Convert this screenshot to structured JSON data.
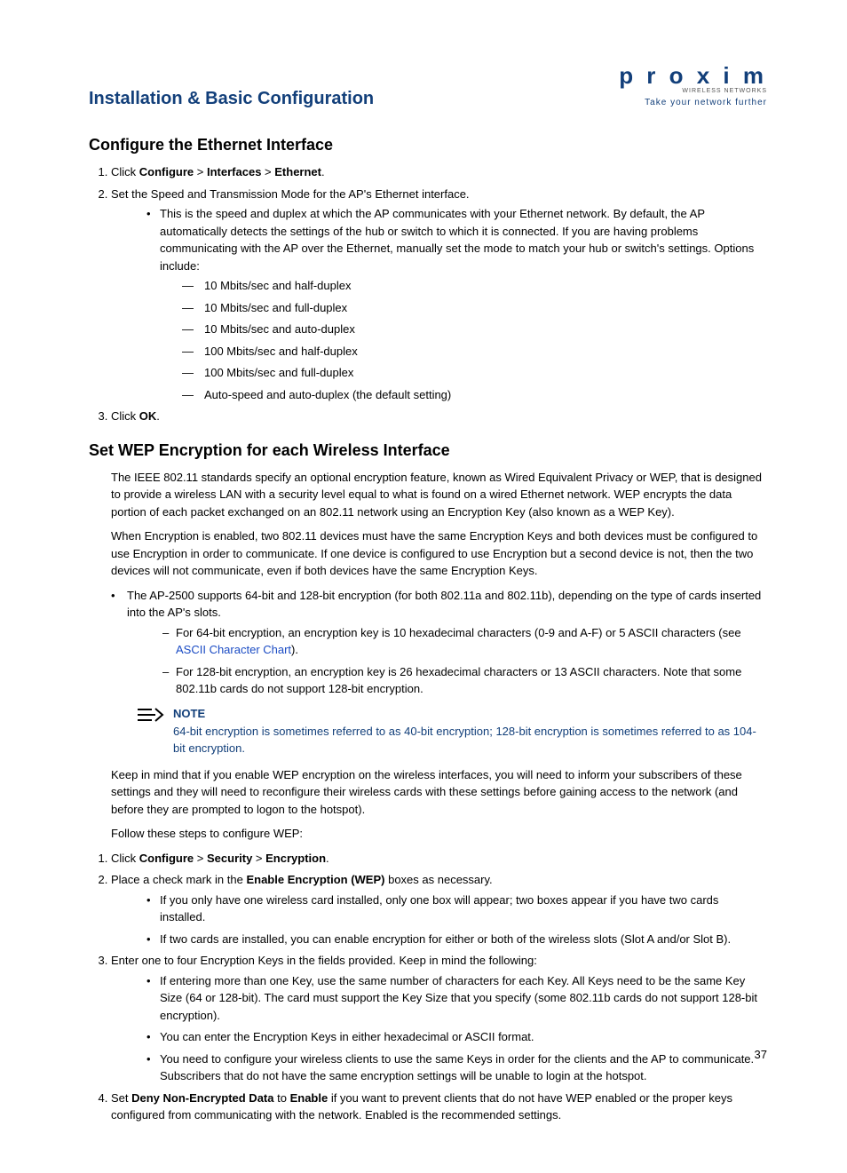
{
  "header": {
    "chapter_title": "Installation & Basic Configuration",
    "logo_main": "p r o x i m",
    "logo_sub": "WIRELESS NETWORKS",
    "logo_tag": "Take your network further"
  },
  "s1": {
    "title": "Configure the Ethernet Interface",
    "step1_pre": "Click ",
    "step1_b1": "Configure",
    "step1_m1": " > ",
    "step1_b2": "Interfaces",
    "step1_m2": " > ",
    "step1_b3": "Ethernet",
    "step1_post": ".",
    "step2": "Set the Speed and Transmission Mode for the AP's Ethernet interface.",
    "step2_bul": "This is the speed and duplex at which the AP communicates with your Ethernet network. By default, the AP automatically detects the settings of the hub or switch to which it is connected. If you are having problems communicating with the AP over the Ethernet, manually set the mode to match your hub or switch's settings. Options include:",
    "opts": [
      "10 Mbits/sec and half-duplex",
      "10 Mbits/sec and full-duplex",
      "10 Mbits/sec and auto-duplex",
      "100 Mbits/sec and half-duplex",
      "100 Mbits/sec and full-duplex",
      "Auto-speed and auto-duplex (the default setting)"
    ],
    "step3_pre": "Click ",
    "step3_b": "OK",
    "step3_post": "."
  },
  "s2": {
    "title": "Set WEP Encryption for each Wireless Interface",
    "p1": "The IEEE 802.11 standards specify an optional encryption feature, known as Wired Equivalent Privacy or WEP, that is designed to provide a wireless LAN with a security level equal to what is found on a wired Ethernet network. WEP encrypts the data portion of each packet exchanged on an 802.11 network using an Encryption Key (also known as a WEP Key).",
    "p2": "When Encryption is enabled, two 802.11 devices must have the same Encryption Keys and both devices must be configured to use Encryption in order to communicate. If one device is configured to use Encryption but a second device is not, then the two devices will not communicate, even if both devices have the same Encryption Keys.",
    "bul1": "The AP-2500 supports 64-bit and 128-bit encryption (for both 802.11a and 802.11b), depending on the type of cards inserted into the AP's slots.",
    "sub1_pre": "For 64-bit encryption, an encryption key is 10 hexadecimal characters (0-9 and A-F) or 5 ASCII characters (see ",
    "sub1_link": "ASCII Character Chart",
    "sub1_post": ").",
    "sub2": "For 128-bit encryption, an encryption key is 26 hexadecimal characters or 13 ASCII characters. Note that some 802.11b cards do not support 128-bit encryption.",
    "note_label": "NOTE",
    "note_text": "64-bit encryption is sometimes referred to as 40-bit encryption; 128-bit encryption is sometimes referred to as 104-bit encryption.",
    "p3": "Keep in mind that if you enable WEP encryption on the wireless interfaces, you will need to inform your subscribers of these settings and they will need to reconfigure their wireless cards with these settings before gaining access to the network (and before they are prompted to logon to the hotspot).",
    "p4": "Follow these steps to configure WEP:",
    "step1_pre": "Click ",
    "step1_b1": "Configure",
    "step1_m1": " > ",
    "step1_b2": "Security",
    "step1_m2": " > ",
    "step1_b3": "Encryption",
    "step1_post": ".",
    "step2_pre": "Place a check mark in the ",
    "step2_b": "Enable Encryption (WEP)",
    "step2_post": " boxes as necessary.",
    "step2_bul1": "If you only have one wireless card installed, only one box will appear; two boxes appear if you have two cards installed.",
    "step2_bul2": "If two cards are installed, you can enable encryption for either or both of the wireless slots (Slot A and/or Slot B).",
    "step3": "Enter one to four Encryption Keys in the fields provided. Keep in mind the following:",
    "step3_bul1": "If entering more than one Key, use the same number of characters for each Key. All Keys need to be the same Key Size (64 or 128-bit). The card must support the Key Size that you specify (some 802.11b cards do not support 128-bit encryption).",
    "step3_bul2": "You can enter the Encryption Keys in either hexadecimal or ASCII format.",
    "step3_bul3": "You need to configure your wireless clients to use the same Keys in order for the clients and the AP to communicate. Subscribers that do not have the same encryption settings will be unable to login at the hotspot.",
    "step4_pre": "Set ",
    "step4_b1": "Deny Non-Encrypted Data",
    "step4_m1": " to ",
    "step4_b2": "Enable",
    "step4_post": " if you want to prevent clients that do not have WEP enabled or the proper keys configured from communicating with the network. Enabled is the recommended settings."
  },
  "page_number": "37"
}
